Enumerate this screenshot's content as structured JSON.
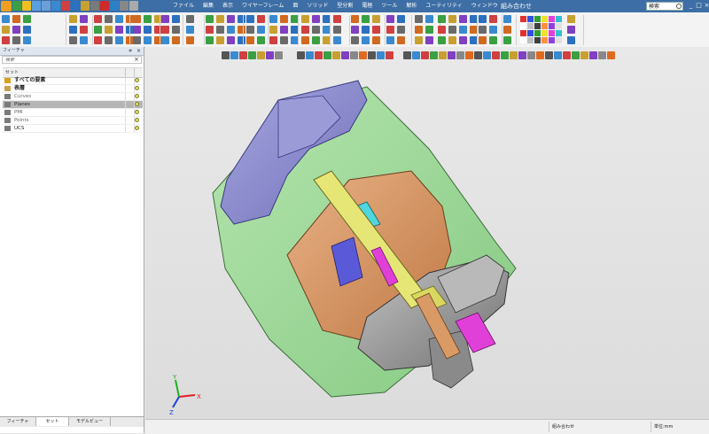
{
  "window": {
    "title": "組み合わせ",
    "search_placeholder": "検索",
    "buttons": [
      "_",
      "□",
      "×"
    ]
  },
  "menu": [
    "ファイル",
    "編集",
    "表示",
    "ワイヤーフレーム",
    "面",
    "ソリッド",
    "型分割",
    "電極",
    "ツール",
    "解析",
    "ユーティリティ",
    "ウィンドウ"
  ],
  "colors": {
    "titlebar": "#3d6ea5",
    "selection": "#b5b5b5",
    "model_green": "#9ed89a",
    "model_purple": "#8e8ed0",
    "model_orange": "#d99a65",
    "model_yellow": "#e6e677",
    "model_magenta": "#e040d8",
    "model_cyan": "#4fd6de",
    "model_gray": "#9a9a9a",
    "axis_x": "#e02020",
    "axis_y": "#20b020",
    "axis_z": "#2040e0"
  },
  "feature_panel": {
    "title": "フィーチャ",
    "search_placeholder": "検索",
    "close_label": "×",
    "pin_label": "ቀ",
    "column_header": "セット",
    "rows": [
      {
        "label": "すべての要素",
        "icon": "all-elements-icon",
        "style": "bold",
        "selected": false
      },
      {
        "label": "表層",
        "icon": "layer-icon",
        "style": "bold",
        "selected": false
      },
      {
        "label": "Curves",
        "icon": "curves-set-icon",
        "style": "gray",
        "selected": false
      },
      {
        "label": "Planes",
        "icon": "planes-set-icon",
        "style": "normal",
        "selected": true
      },
      {
        "label": "PMI",
        "icon": "pmi-set-icon",
        "style": "gray",
        "selected": false
      },
      {
        "label": "Points",
        "icon": "points-set-icon",
        "style": "gray",
        "selected": false
      },
      {
        "label": "UCS",
        "icon": "ucs-set-icon",
        "style": "normal",
        "selected": false
      }
    ],
    "tabs": [
      {
        "label": "フィーチャ",
        "active": false
      },
      {
        "label": "セット",
        "active": true
      },
      {
        "label": "モデルビュー",
        "active": false
      }
    ]
  },
  "triad": {
    "x": "X",
    "y": "Y",
    "z": "Z"
  },
  "status": {
    "units": "単位:mm",
    "cell1": "組み合わせ"
  }
}
